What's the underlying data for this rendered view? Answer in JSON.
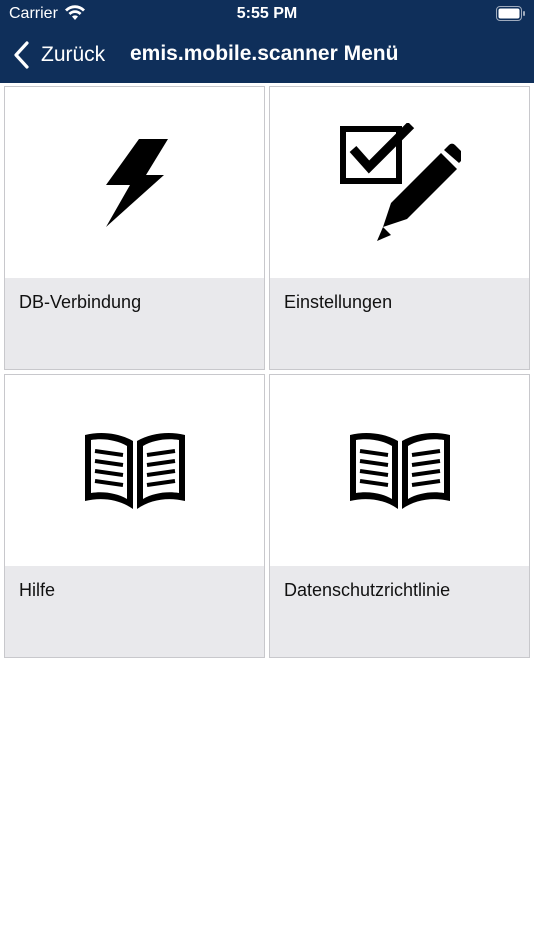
{
  "status_bar": {
    "carrier": "Carrier",
    "time": "5:55 PM",
    "icons": [
      "wifi-icon",
      "battery-icon"
    ]
  },
  "nav": {
    "back_label": "Zurück",
    "title": "emis.mobile.scanner Menü",
    "back_icon": "chevron-left-icon"
  },
  "colors": {
    "header_bg": "#0f2f5a",
    "tile_label_bg": "#e9e9ec",
    "tile_border": "#c8c8cc"
  },
  "menu": {
    "items": [
      {
        "label": "DB-Verbindung",
        "icon": "lightning-bolt-icon"
      },
      {
        "label": "Einstellungen",
        "icon": "checkbox-pencil-icon"
      },
      {
        "label": "Hilfe",
        "icon": "open-book-icon"
      },
      {
        "label": "Datenschutzrichtlinie",
        "icon": "open-book-icon"
      }
    ]
  }
}
